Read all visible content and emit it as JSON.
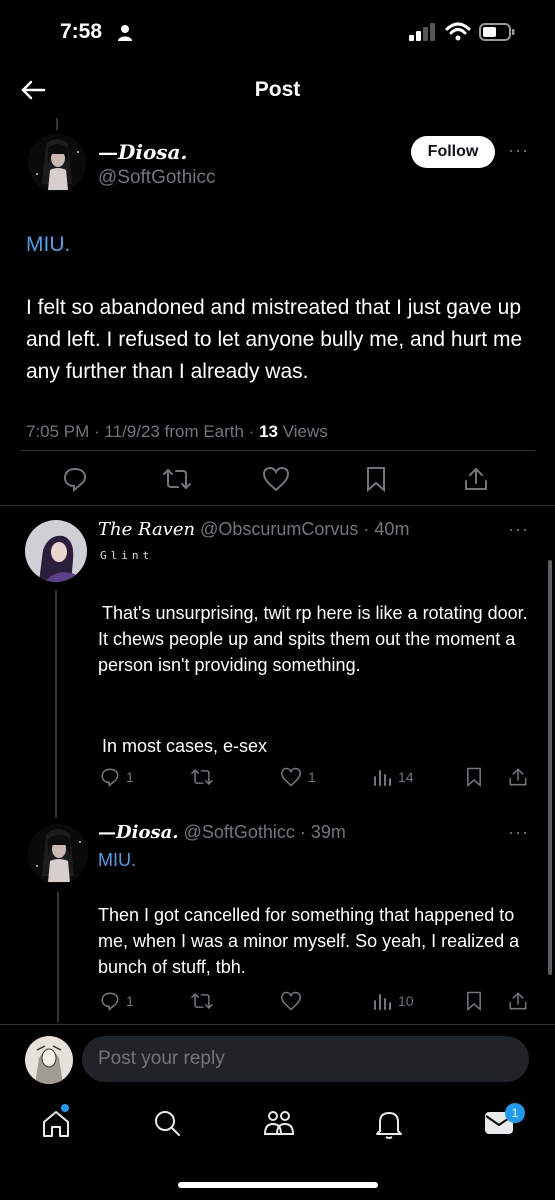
{
  "status": {
    "time": "7:58"
  },
  "nav": {
    "title": "Post"
  },
  "main_post": {
    "display_name": "—Diosa.",
    "handle": "@SoftGothicc",
    "follow_label": "Follow",
    "tag": "MIU.",
    "body": "I felt so abandoned and mistreated that I just gave up and left. I refused to let anyone bully me, and hurt me any further than I already was.",
    "time": "7:05 PM",
    "date": "11/9/23",
    "source": "from Earth",
    "views_count": "13",
    "views_label": "Views"
  },
  "replies": [
    {
      "display_name": "The Raven",
      "handle": "@ObscurumCorvus",
      "age": "40m",
      "subtitle": "Glint",
      "body_1": "That's unsurprising, twit rp here is like a rotating door. It chews people up and spits them out the moment a person isn't providing something.",
      "body_2": "In most cases, e-sex",
      "reply_count": "1",
      "like_count": "1",
      "view_count": "14"
    },
    {
      "display_name": "—Diosa.",
      "handle": "@SoftGothicc",
      "age": "39m",
      "tag": "MIU.",
      "body": "Then I got cancelled for something that happened to me, when I was a minor myself. So yeah, I realized a bunch of stuff, tbh.",
      "reply_count": "1",
      "view_count": "10"
    }
  ],
  "compose": {
    "placeholder": "Post your reply"
  },
  "tabbar": {
    "messages_badge": "1"
  }
}
